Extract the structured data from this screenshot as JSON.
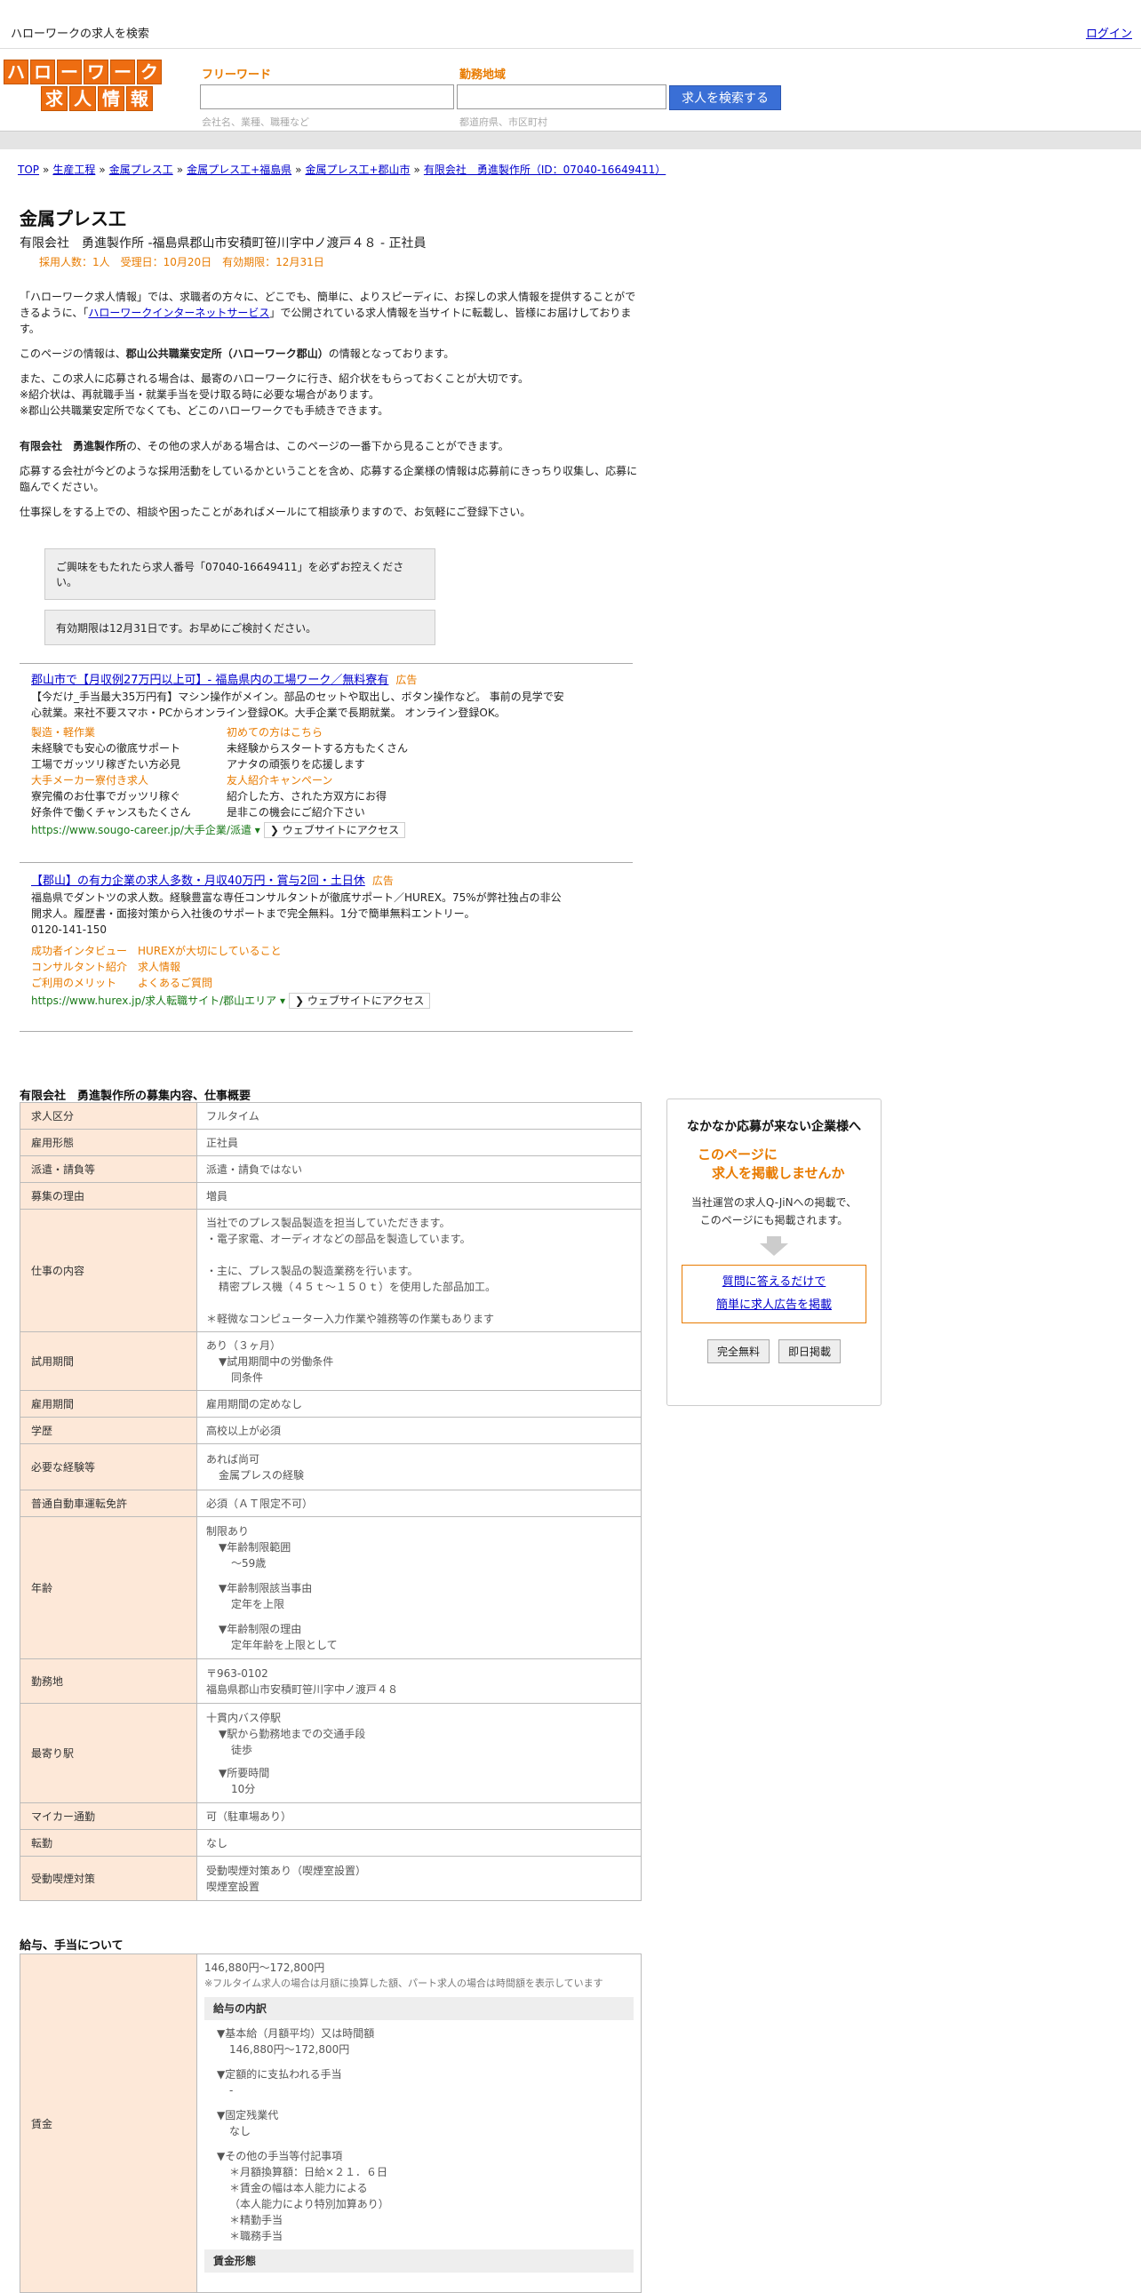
{
  "topbar": {
    "site_title": "ハローワークの求人を検索",
    "login": "ログイン"
  },
  "header": {
    "logo_row1": [
      "ハ",
      "ロ",
      "ー",
      "ワ",
      "ー",
      "ク"
    ],
    "logo_row2": [
      "求",
      "人",
      "情",
      "報"
    ],
    "freeword_label": "フリーワード",
    "freeword_placeholder": "会社名、業種、職種など",
    "area_label": "勤務地域",
    "area_placeholder": "都道府県、市区町村",
    "search_button": "求人を検索する"
  },
  "breadcrumb": [
    "TOP",
    "生産工程",
    "金属プレス工",
    "金属プレス工+福島県",
    "金属プレス工+郡山市",
    "有限会社　勇進製作所（ID：07040-16649411）"
  ],
  "job": {
    "title": "金属プレス工",
    "subtitle": "有限会社　勇進製作所 -福島県郡山市安積町笹川字中ノ渡戸４８ - 正社員",
    "meta": "採用人数：1人　受理日：10月20日　有効期限：12月31日"
  },
  "intro": {
    "p1_a": "「ハローワーク求人情報」では、求職者の方々に、どこでも、簡単に、よりスピーディに、お探しの求人情報を提供することができるように、「",
    "p1_link": "ハローワークインターネットサービス",
    "p1_b": "」で公開されている求人情報を当サイトに転載し、皆様にお届けしております。",
    "p2_a": "このページの情報は、",
    "p2_bold": "郡山公共職業安定所（ハローワーク郡山）",
    "p2_b": "の情報となっております。",
    "p3_1": "また、この求人に応募される場合は、最寄のハローワークに行き、紹介状をもらっておくことが大切です。",
    "p3_2": "※紹介状は、再就職手当・就業手当を受け取る時に必要な場合があります。",
    "p3_3": "※郡山公共職業安定所でなくても、どこのハローワークでも手続きできます。",
    "p4_bold": "有限会社　勇進製作所",
    "p4_rest": "の、その他の求人がある場合は、このページの一番下から見ることができます。",
    "p5": "応募する会社が今どのような採用活動をしているかということを含め、応募する企業様の情報は応募前にきっちり収集し、応募に臨んでください。",
    "p6": "仕事探しをする上での、相談や困ったことがあればメールにて相談承りますので、お気軽にご登録下さい。"
  },
  "notices": {
    "n1": "ご興味をもたれたら求人番号「07040-16649411」を必ずお控えください。",
    "n2": "有効期限は12月31日です。お早めにご検討ください。"
  },
  "ads": [
    {
      "title": "郡山市で【月収例27万円以上可】- 福島県内の工場ワーク／無料寮有",
      "badge": "広告",
      "desc": "【今だけ_手当最大35万円有】マシン操作がメイン。部品のセットや取出し、ボタン操作など。 事前の見学で安心就業。来社不要スマホ・PCからオンライン登録OK。大手企業で長期就業。 オンライン登録OK。",
      "cols": [
        {
          "head": "製造・軽作業",
          "lines": [
            "未経験でも安心の徹底サポート",
            "工場でガッツリ稼ぎたい方必見"
          ]
        },
        {
          "head": "初めての方はこちら",
          "lines": [
            "未経験からスタートする方もたくさん",
            "アナタの頑張りを応援します"
          ]
        },
        {
          "head": "大手メーカー寮付き求人",
          "lines": [
            "寮完備のお仕事でガッツリ稼ぐ",
            "好条件で働くチャンスもたくさん"
          ]
        },
        {
          "head": "友人紹介キャンペーン",
          "lines": [
            "紹介した方、された方双方にお得",
            "是非この機会にご紹介下さい"
          ]
        }
      ],
      "url": "https://www.sougo-career.jp/大手企業/派遣",
      "access": "ウェブサイトにアクセス"
    },
    {
      "title": "【郡山】の有力企業の求人多数・月収40万円・賞与2回・土日休",
      "badge": "広告",
      "desc": "福島県でダントツの求人数。経験豊富な専任コンサルタントが徹底サポート／HUREX。75%が弊社独占の非公開求人。履歴書・面接対策から入社後のサポートまで完全無料。1分で簡単無料エントリー。",
      "phone": "0120-141-150",
      "links": [
        [
          "成功者インタビュー",
          "HUREXが大切にしていること"
        ],
        [
          "コンサルタント紹介",
          "求人情報"
        ],
        [
          "ご利用のメリット",
          "よくあるご質問"
        ]
      ],
      "url": "https://www.hurex.jp/求人転職サイト/郡山エリア",
      "access": "ウェブサイトにアクセス"
    }
  ],
  "summary": {
    "title": "有限会社　勇進製作所の募集内容、仕事概要",
    "rows": {
      "kubun": {
        "k": "求人区分",
        "v": "フルタイム"
      },
      "keitai": {
        "k": "雇用形態",
        "v": "正社員"
      },
      "haken": {
        "k": "派遣・請負等",
        "v": "派遣・請負ではない"
      },
      "riyu": {
        "k": "募集の理由",
        "v": "増員"
      },
      "naiyo": {
        "k": "仕事の内容",
        "l1": "当社でのプレス製品製造を担当していただきます。",
        "l2": "・電子家電、オーディオなどの部品を製造しています。",
        "l3": "・主に、プレス製品の製造業務を行います。",
        "l4": "精密プレス機（４５ｔ～１５０ｔ）を使用した部品加工。",
        "l5": "＊軽微なコンピューター入力作業や雑務等の作業もあります"
      },
      "shiyo": {
        "k": "試用期間",
        "l1": "あり（３ヶ月）",
        "l2": "▼試用期間中の労働条件",
        "l3": "同条件"
      },
      "kikan": {
        "k": "雇用期間",
        "v": "雇用期間の定めなし"
      },
      "gakureki": {
        "k": "学歴",
        "v": "高校以上が必須"
      },
      "keiken": {
        "k": "必要な経験等",
        "l1": "あれば尚可",
        "l2": "金属プレスの経験"
      },
      "menkyo": {
        "k": "普通自動車運転免許",
        "v": "必須（ＡＴ限定不可）"
      },
      "nenrei": {
        "k": "年齢",
        "l1": "制限あり",
        "l2": "▼年齢制限範囲",
        "l3": "〜59歳",
        "l4": "▼年齢制限該当事由",
        "l5": "定年を上限",
        "l6": "▼年齢制限の理由",
        "l7": "定年年齢を上限として"
      },
      "kinmuchi": {
        "k": "勤務地",
        "l1": "〒963-0102",
        "l2": "福島県郡山市安積町笹川字中ノ渡戸４８"
      },
      "eki": {
        "k": "最寄り駅",
        "l1": "十貫内バス停駅",
        "l2": "▼駅から勤務地までの交通手段",
        "l3": "徒歩",
        "l4": "▼所要時間",
        "l5": "10分"
      },
      "mycar": {
        "k": "マイカー通勤",
        "v": "可（駐車場あり）"
      },
      "tenkin": {
        "k": "転勤",
        "v": "なし"
      },
      "judo": {
        "k": "受動喫煙対策",
        "l1": "受動喫煙対策あり（喫煙室設置）",
        "l2": "喫煙室設置"
      }
    }
  },
  "side": {
    "heading": "なかなか応募が来ない企業様へ",
    "offer_1": "このページに",
    "offer_2": "求人を掲載しませんか",
    "desc_1": "当社運営の求人Q-JiNへの掲載で、",
    "desc_2": "このページにも掲載されます。",
    "link_1": "質問に答えるだけで",
    "link_2": "簡単に求人広告を掲載",
    "btn_1": "完全無料",
    "btn_2": "即日掲載"
  },
  "wage": {
    "title": "給与、手当について",
    "key": "賃金",
    "range": "146,880円〜172,800円",
    "note": "※フルタイム求人の場合は月額に換算した額、パート求人の場合は時間額を表示しています",
    "breakdown_head": "給与の内訳",
    "b1": "▼基本給（月額平均）又は時間額",
    "b1v": "146,880円〜172,800円",
    "b2": "▼定額的に支払われる手当",
    "b2v": "-",
    "b3": "▼固定残業代",
    "b3v": "なし",
    "b4": "▼その他の手当等付記事項",
    "b4v1": "＊月額換算額：日給×２１．６日",
    "b4v2": "＊賃金の幅は本人能力による",
    "b4v3": "（本人能力により特別加算あり）",
    "b4v4": "＊精勤手当",
    "b4v5": "＊職務手当",
    "form_head": "賃金形態"
  }
}
